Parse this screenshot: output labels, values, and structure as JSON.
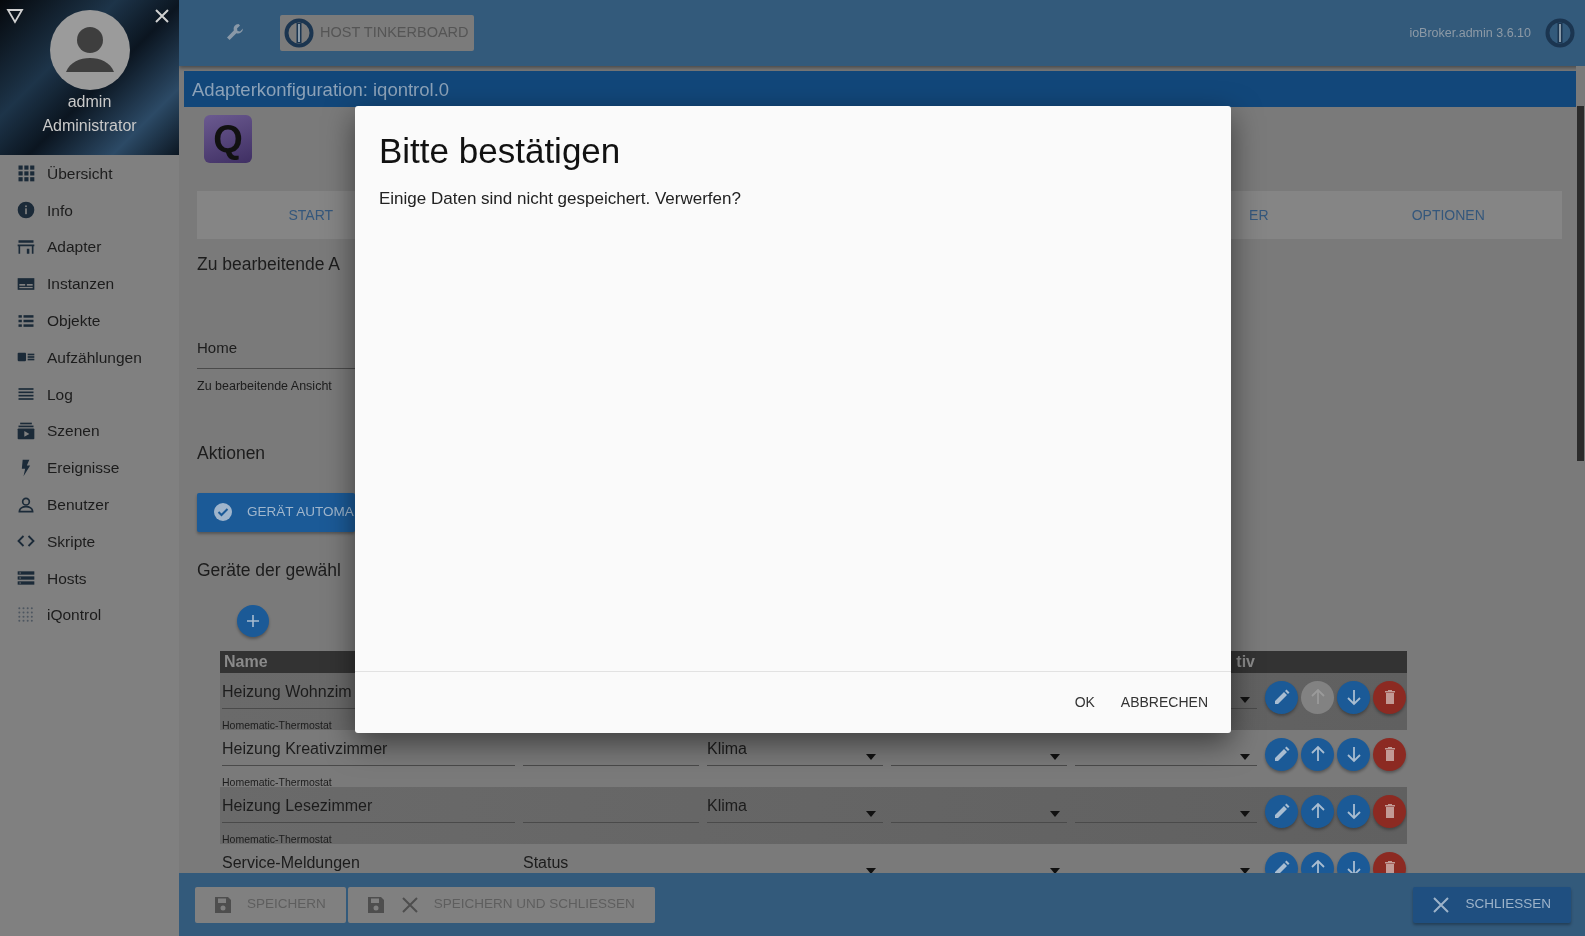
{
  "sidebar": {
    "user_name": "admin",
    "user_role": "Administrator",
    "items": [
      {
        "label": "Übersicht",
        "selected": false
      },
      {
        "label": "Info",
        "selected": false
      },
      {
        "label": "Adapter",
        "selected": false
      },
      {
        "label": "Instanzen",
        "selected": false
      },
      {
        "label": "Objekte",
        "selected": false
      },
      {
        "label": "Aufzählungen",
        "selected": false
      },
      {
        "label": "Log",
        "selected": false
      },
      {
        "label": "Szenen",
        "selected": false
      },
      {
        "label": "Ereignisse",
        "selected": false
      },
      {
        "label": "Benutzer",
        "selected": false
      },
      {
        "label": "Skripte",
        "selected": false
      },
      {
        "label": "Hosts",
        "selected": false
      },
      {
        "label": "iQontrol",
        "selected": false
      }
    ]
  },
  "topbar": {
    "host_button": "HOST TINKERBOARD",
    "version": "ioBroker.admin 3.6.10"
  },
  "page": {
    "title": "Adapterkonfiguration: iqontrol.0",
    "adapter_logo": "Q",
    "tabs": [
      {
        "label": "START",
        "selected": false
      },
      {
        "label": "ER",
        "selected": false
      },
      {
        "label": "OPTIONEN",
        "selected": false
      }
    ],
    "view_heading": "Zu bearbeitende A",
    "view_field": {
      "value": "Home",
      "label": "Zu bearbeitende Ansicht"
    },
    "actions_heading": "Aktionen",
    "action_button": "GERÄT AUTOMA",
    "devices_heading": "Geräte der gewähl",
    "table": {
      "columns": [
        {
          "label": "Name"
        },
        {
          "label": "tiv"
        }
      ],
      "rows": [
        {
          "cells": [
            {
              "kind": "name",
              "value": "Heizung Wohnzim"
            },
            {
              "kind": "hidden"
            },
            {
              "kind": "hidden"
            },
            {
              "kind": "hidden"
            },
            {
              "kind": "select"
            }
          ],
          "subtitle": "Homematic-Thermostat",
          "actions": [
            {
              "kind": "edit",
              "disabled": false
            },
            {
              "kind": "up",
              "disabled": true
            },
            {
              "kind": "down",
              "disabled": false
            },
            {
              "kind": "delete",
              "disabled": false
            }
          ]
        },
        {
          "cells": [
            {
              "kind": "name",
              "value": "Heizung Kreativzimmer"
            },
            {
              "kind": "text"
            },
            {
              "kind": "select",
              "value": "Klima"
            },
            {
              "kind": "select"
            },
            {
              "kind": "select"
            }
          ],
          "subtitle": "Homematic-Thermostat",
          "actions": [
            {
              "kind": "edit",
              "disabled": false
            },
            {
              "kind": "up",
              "disabled": false
            },
            {
              "kind": "down",
              "disabled": false
            },
            {
              "kind": "delete",
              "disabled": false
            }
          ]
        },
        {
          "cells": [
            {
              "kind": "name",
              "value": "Heizung Lesezimmer"
            },
            {
              "kind": "text"
            },
            {
              "kind": "select",
              "value": "Klima"
            },
            {
              "kind": "select"
            },
            {
              "kind": "select"
            }
          ],
          "subtitle": "Homematic-Thermostat",
          "actions": [
            {
              "kind": "edit",
              "disabled": false
            },
            {
              "kind": "up",
              "disabled": false
            },
            {
              "kind": "down",
              "disabled": false
            },
            {
              "kind": "delete",
              "disabled": false
            }
          ]
        },
        {
          "cells": [
            {
              "kind": "name",
              "value": "Service-Meldungen"
            },
            {
              "kind": "wide_select",
              "value": "Status"
            },
            {
              "kind": "select"
            },
            {
              "kind": "select"
            }
          ],
          "actions": [
            {
              "kind": "edit",
              "disabled": false
            },
            {
              "kind": "up",
              "disabled": false
            },
            {
              "kind": "down",
              "disabled": false
            },
            {
              "kind": "delete",
              "disabled": false
            }
          ]
        }
      ]
    }
  },
  "footer": {
    "buttons": [
      {
        "label": "SPEICHERN",
        "kind": "save"
      },
      {
        "label": "SPEICHERN UND SCHLIESSEN",
        "kind": "save_close"
      },
      {
        "label": "SCHLIESSEN",
        "kind": "close"
      }
    ]
  },
  "dialog": {
    "title": "Bitte bestätigen",
    "message": "Einige Daten sind nicht gespeichert. Verwerfen?",
    "buttons": [
      "OK",
      "ABBRECHEN"
    ]
  }
}
